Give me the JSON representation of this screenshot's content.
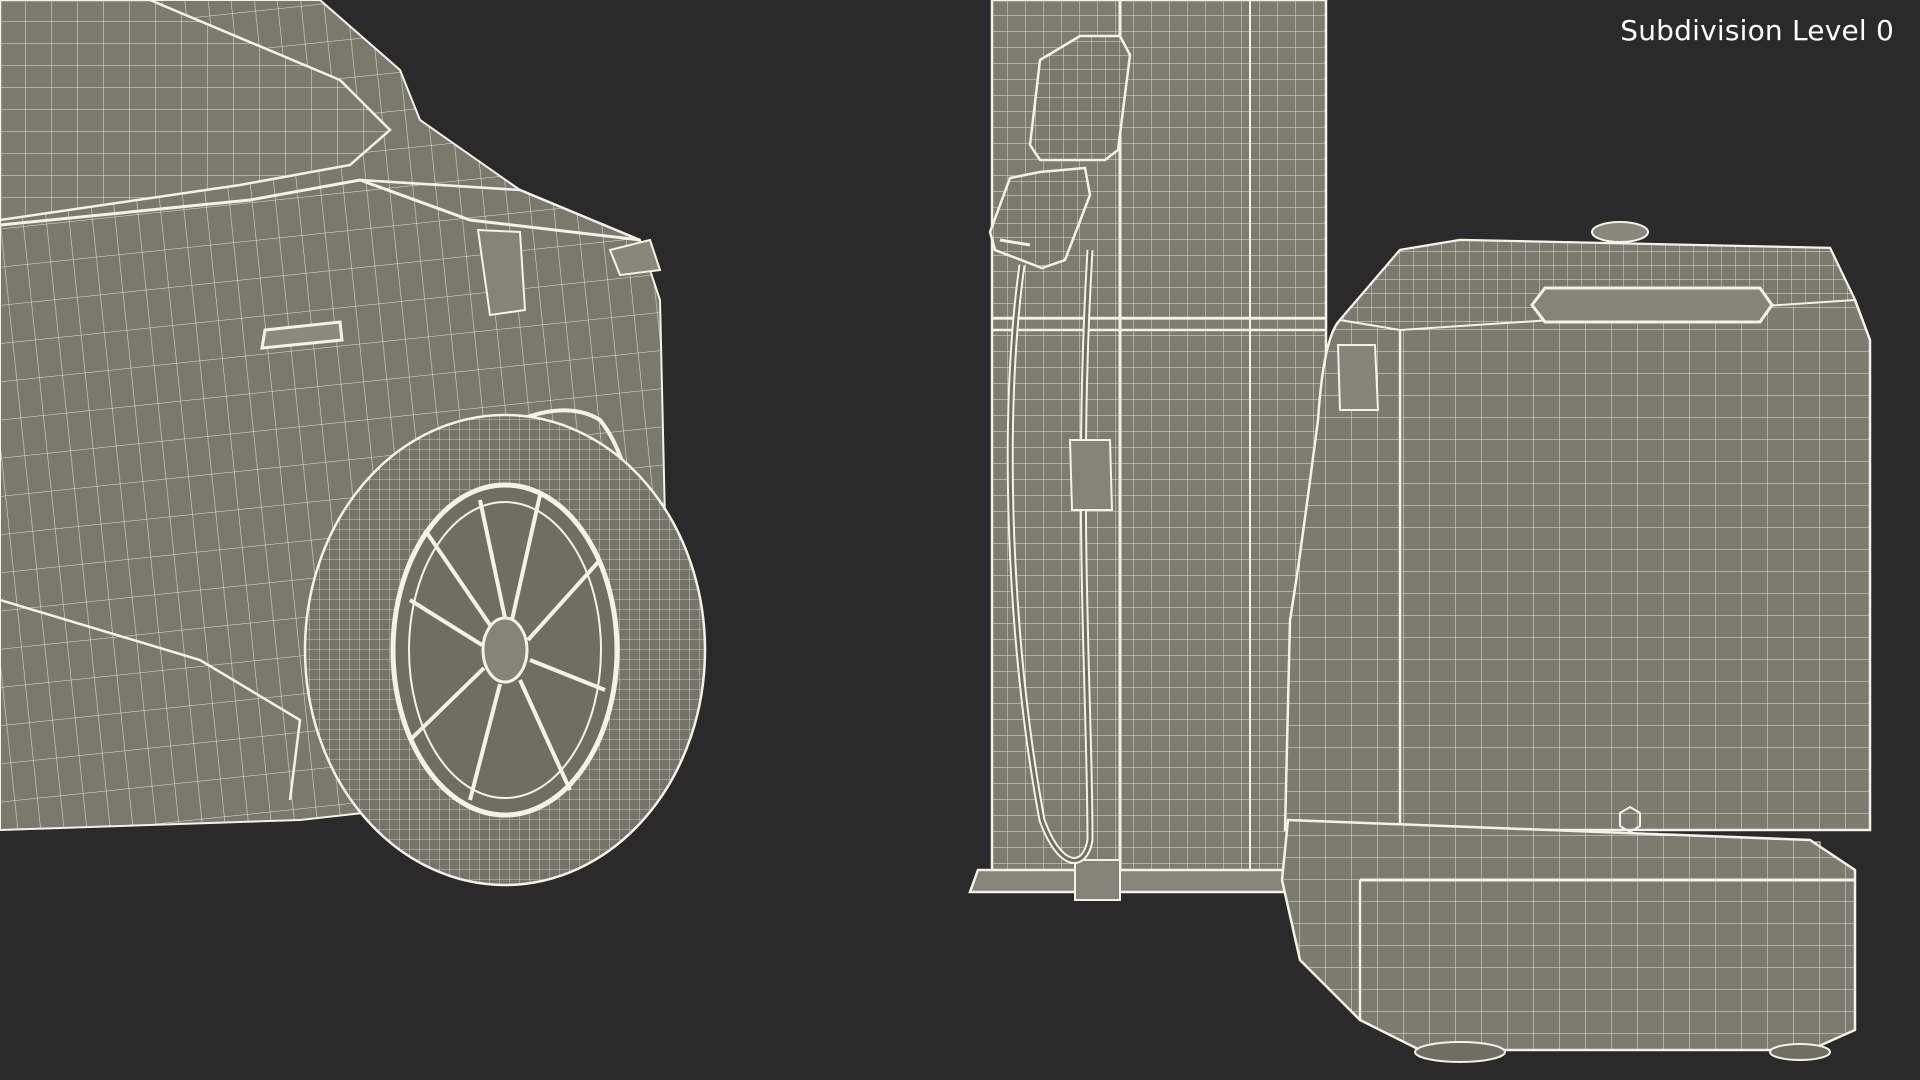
{
  "viewport": {
    "overlay_label": "Subdivision Level 0",
    "background_color": "#2a2a2a",
    "wire_color": "#ffffff",
    "surface_color": "#7b7a6f"
  },
  "scene": {
    "objects": [
      "car-front",
      "charging-post",
      "charger-handle",
      "charging-cable",
      "charging-robot"
    ]
  }
}
